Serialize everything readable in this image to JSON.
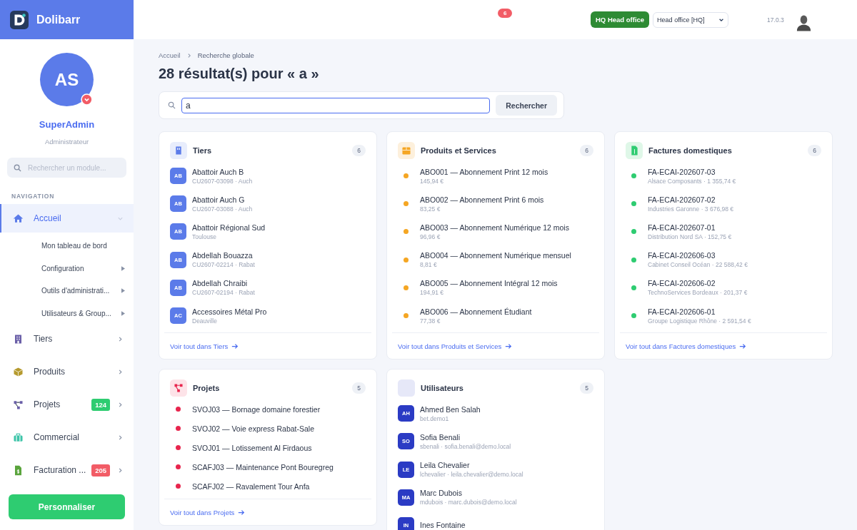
{
  "app": {
    "name": "Dolibarr"
  },
  "topbar": {
    "notifications": "6",
    "entity_badge": "HQ Head office",
    "entity_select": "Head office [HQ]",
    "version": "17.0.3"
  },
  "user": {
    "initials": "AS",
    "name": "SuperAdmin",
    "role": "Administrateur"
  },
  "sidebar": {
    "search": {
      "placeholder": "Rechercher un module..."
    },
    "section_label": "NAVIGATION",
    "items": [
      {
        "label": "Accueil",
        "selected": true,
        "expanded": true,
        "children": [
          {
            "label": "Mon tableau de bord",
            "has_arrow": false
          },
          {
            "label": "Configuration",
            "has_arrow": true
          },
          {
            "label": "Outils d'administrati...",
            "has_arrow": true
          },
          {
            "label": "Utilisateurs & Group...",
            "has_arrow": true
          }
        ]
      },
      {
        "label": "Tiers",
        "selected": false,
        "expanded": false
      },
      {
        "label": "Produits",
        "selected": false,
        "expanded": false
      },
      {
        "label": "Projets",
        "selected": false,
        "expanded": false,
        "badge": "124",
        "color": "#2ecc71"
      },
      {
        "label": "Commercial",
        "selected": false,
        "expanded": false
      },
      {
        "label": "Facturation ...",
        "selected": false,
        "expanded": false,
        "badge": "205",
        "color": "#f25c66"
      }
    ],
    "button": "Personnaliser"
  },
  "breadcrumb": [
    "Accueil",
    "Recherche globale"
  ],
  "heading": "28 résultat(s) pour « a »",
  "search": {
    "value": "a",
    "button": "Rechercher"
  },
  "sections": [
    {
      "title": "Tiers",
      "count": "6",
      "kind": "avatar",
      "color": "#5b7be9",
      "link": "Voir tout dans Tiers",
      "items": [
        {
          "initials": "AB",
          "title": "Abattoir Auch B",
          "subtitle": "CU2607-03098 · Auch"
        },
        {
          "initials": "AB",
          "title": "Abattoir Auch G",
          "subtitle": "CU2607-03088 · Auch"
        },
        {
          "initials": "AB",
          "title": "Abattoir Régional Sud",
          "subtitle": "Toulouse"
        },
        {
          "initials": "AB",
          "title": "Abdellah Bouazza",
          "subtitle": "CU2607-02214 · Rabat"
        },
        {
          "initials": "AB",
          "title": "Abdellah Chraibi",
          "subtitle": "CU2607-02194 · Rabat"
        },
        {
          "initials": "AC",
          "title": "Accessoires Métal Pro",
          "subtitle": "Deauville"
        }
      ]
    },
    {
      "title": "Produits et Services",
      "count": "6",
      "kind": "dot",
      "color": "#f5a623",
      "link": "Voir tout dans Produits et Services",
      "items": [
        {
          "title": "ABO001 — Abonnement Print 12 mois",
          "subtitle": "145,94 €"
        },
        {
          "title": "ABO002 — Abonnement Print 6 mois",
          "subtitle": "83,25 €"
        },
        {
          "title": "ABO003 — Abonnement Numérique 12 mois",
          "subtitle": "96,96 €"
        },
        {
          "title": "ABO004 — Abonnement Numérique mensuel",
          "subtitle": "8,81 €"
        },
        {
          "title": "ABO005 — Abonnement Intégral 12 mois",
          "subtitle": "194,91 €"
        },
        {
          "title": "ABO006 — Abonnement Étudiant",
          "subtitle": "77,38 €"
        }
      ]
    },
    {
      "title": "Factures domestiques",
      "count": "6",
      "kind": "dot",
      "color": "#2ecc71",
      "link": "Voir tout dans Factures domestiques",
      "items": [
        {
          "title": "FA-ECAI-202607-03",
          "subtitle": "Alsace Composants · 1 355,74 €"
        },
        {
          "title": "FA-ECAI-202607-02",
          "subtitle": "Industries Garonne · 3 676,98 €"
        },
        {
          "title": "FA-ECAI-202607-01",
          "subtitle": "Distribution Nord SA · 152,75 €"
        },
        {
          "title": "FA-ECAI-202606-03",
          "subtitle": "Cabinet Conseil Océan · 22 588,42 €"
        },
        {
          "title": "FA-ECAI-202606-02",
          "subtitle": "TechnoServices Bordeaux · 201,37 €"
        },
        {
          "title": "FA-ECAI-202606-01",
          "subtitle": "Groupe Logistique Rhône · 2 591,54 €"
        }
      ]
    },
    {
      "title": "Projets",
      "count": "5",
      "kind": "dot",
      "color": "#e8254d",
      "link": "Voir tout dans Projets",
      "items": [
        {
          "title": "SVOJ03 — Bornage domaine forestier"
        },
        {
          "title": "SVOJ02 — Voie express Rabat-Sale"
        },
        {
          "title": "SVOJ01 — Lotissement Al Firdaous"
        },
        {
          "title": "SCAFJ03 — Maintenance Pont Bouregreg"
        },
        {
          "title": "SCAFJ02 — Ravalement Tour Anfa"
        }
      ]
    },
    {
      "title": "Utilisateurs",
      "count": "5",
      "kind": "avatar",
      "color": "#2b3bc4",
      "items": [
        {
          "initials": "AH",
          "title": "Ahmed Ben Salah",
          "subtitle": "bet.demo1"
        },
        {
          "initials": "SO",
          "title": "Sofia Benali",
          "subtitle": "sbenali · sofia.benali@demo.local"
        },
        {
          "initials": "LE",
          "title": "Leila Chevalier",
          "subtitle": "lchevalier · leila.chevalier@demo.local"
        },
        {
          "initials": "MA",
          "title": "Marc Dubois",
          "subtitle": "mdubois · marc.dubois@demo.local"
        },
        {
          "initials": "IN",
          "title": "Ines Fontaine"
        }
      ]
    }
  ]
}
